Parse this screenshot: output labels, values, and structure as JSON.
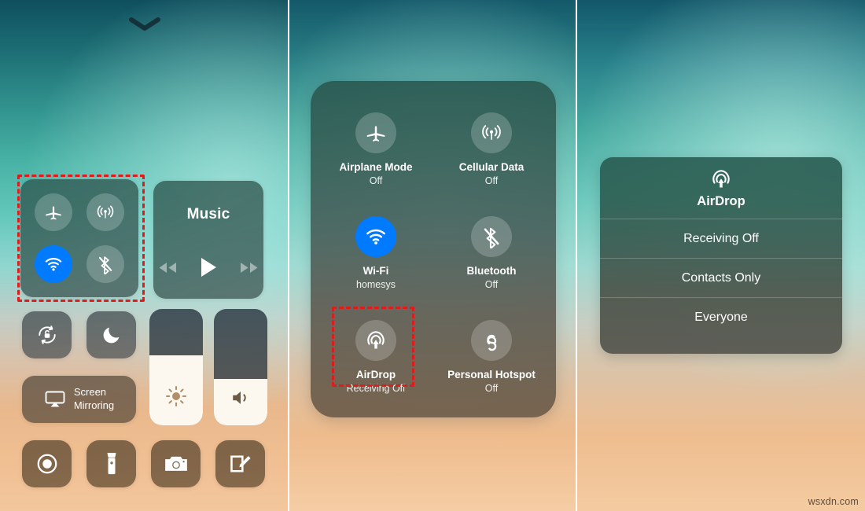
{
  "watermark": "wsxdn.com",
  "panels": {
    "left": {
      "name": "control-center-overview",
      "chevron_icon": "chevron-down-icon",
      "connectivity": {
        "toggles": [
          {
            "icon": "airplane-icon",
            "label": "Airplane Mode",
            "state": "off"
          },
          {
            "icon": "cellular-data-icon",
            "label": "Cellular Data",
            "state": "off"
          },
          {
            "icon": "wifi-icon",
            "label": "Wi-Fi",
            "state": "on"
          },
          {
            "icon": "bluetooth-off-icon",
            "label": "Bluetooth",
            "state": "off"
          }
        ]
      },
      "music": {
        "title": "Music",
        "controls": [
          {
            "icon": "rewind-icon",
            "label": "Rewind"
          },
          {
            "icon": "play-icon",
            "label": "Play"
          },
          {
            "icon": "fast-forward-icon",
            "label": "Fast Forward"
          }
        ]
      },
      "quick_toggles": [
        {
          "icon": "rotation-lock-icon",
          "label": "Rotation Lock"
        },
        {
          "icon": "do-not-disturb-moon-icon",
          "label": "Do Not Disturb"
        }
      ],
      "screen_mirroring": {
        "icon": "screen-mirroring-icon",
        "line1": "Screen",
        "line2": "Mirroring"
      },
      "sliders": [
        {
          "icon": "brightness-icon",
          "label": "Brightness",
          "value": 60
        },
        {
          "icon": "volume-icon",
          "label": "Volume",
          "value": 40
        }
      ],
      "shortcuts": [
        {
          "icon": "screen-record-icon",
          "label": "Screen Recording"
        },
        {
          "icon": "flashlight-icon",
          "label": "Flashlight"
        },
        {
          "icon": "camera-icon",
          "label": "Camera"
        },
        {
          "icon": "notes-icon",
          "label": "Notes"
        }
      ]
    },
    "middle": {
      "name": "connectivity-expanded-card",
      "tiles": [
        {
          "icon": "airplane-icon",
          "label": "Airplane Mode",
          "sub": "Off",
          "state": "off"
        },
        {
          "icon": "cellular-data-icon",
          "label": "Cellular Data",
          "sub": "Off",
          "state": "off"
        },
        {
          "icon": "wifi-icon",
          "label": "Wi-Fi",
          "sub": "homesys",
          "state": "on"
        },
        {
          "icon": "bluetooth-off-icon",
          "label": "Bluetooth",
          "sub": "Off",
          "state": "off"
        },
        {
          "icon": "airdrop-icon",
          "label": "AirDrop",
          "sub": "Receiving Off",
          "state": "off"
        },
        {
          "icon": "personal-hotspot-icon",
          "label": "Personal Hotspot",
          "sub": "Off",
          "state": "off"
        }
      ]
    },
    "right": {
      "name": "airdrop-options-menu",
      "header": {
        "icon": "airdrop-icon",
        "label": "AirDrop"
      },
      "options": [
        {
          "label": "Receiving Off",
          "selected": false
        },
        {
          "label": "Contacts Only",
          "selected": false
        },
        {
          "label": "Everyone",
          "selected": false
        }
      ]
    }
  },
  "colors": {
    "accent_blue": "#007aff",
    "highlight_red": "#e01b1b",
    "label_white": "#ffffff"
  }
}
